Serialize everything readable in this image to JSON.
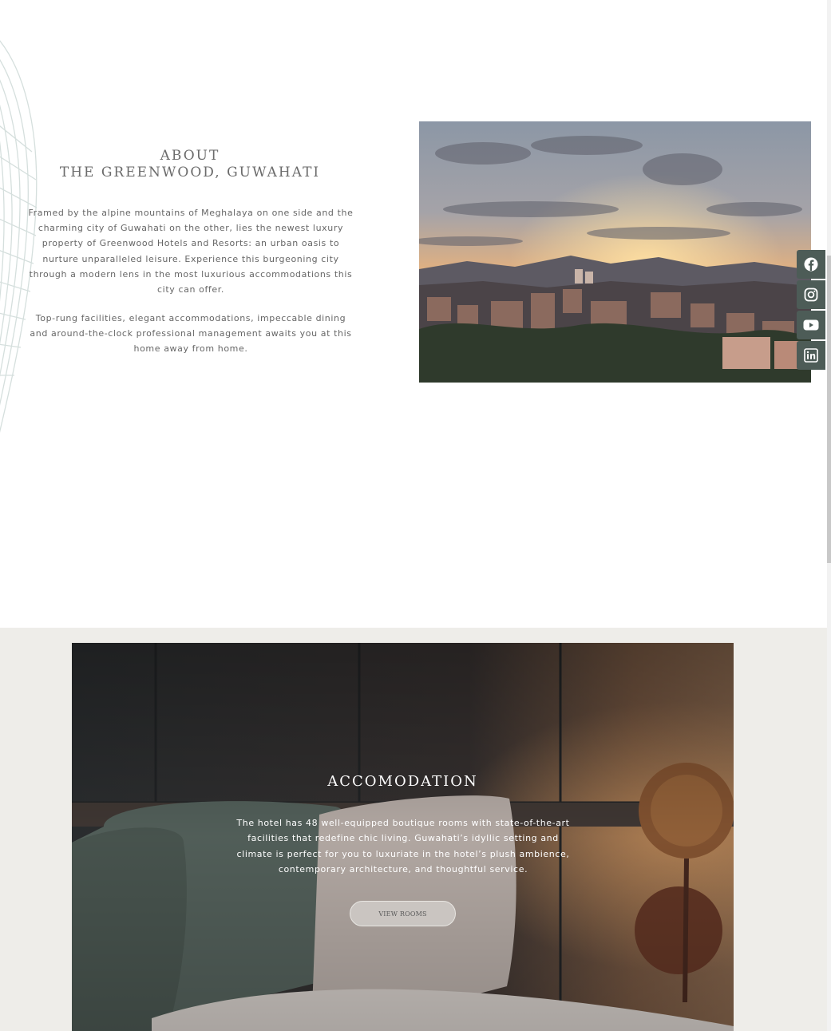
{
  "about": {
    "heading_line1": "ABOUT",
    "heading_line2": "THE GREENWOOD, GUWAHATI",
    "para1": "Framed by the alpine mountains of Meghalaya on one side and the charming city of Guwahati on the other, lies the newest luxury property of Greenwood Hotels and Resorts: an urban oasis to nurture unparalleled leisure. Experience this burgeoning city through a modern lens in the most luxurious accommodations this city can offer.",
    "para2": "Top-rung facilities, elegant accommodations, impeccable dining and around-the-clock professional management awaits you at this home away from home."
  },
  "social": [
    {
      "icon": "facebook-icon"
    },
    {
      "icon": "instagram-icon"
    },
    {
      "icon": "youtube-icon"
    },
    {
      "icon": "linkedin-icon"
    }
  ],
  "accommodation": {
    "title": "ACCOMODATION",
    "text": "The hotel has 48 well-equipped boutique rooms with state-of-the-art facilities that redefine chic living. Guwahati’s idyllic setting and climate is perfect for you to luxuriate in the hotel’s plush ambience, contemporary architecture, and thoughtful service.",
    "button_label": "VIEW ROOMS"
  },
  "colors": {
    "social_bg": "#4d5c57",
    "section_bg": "#eeede9",
    "heading": "#6b6b6b"
  }
}
